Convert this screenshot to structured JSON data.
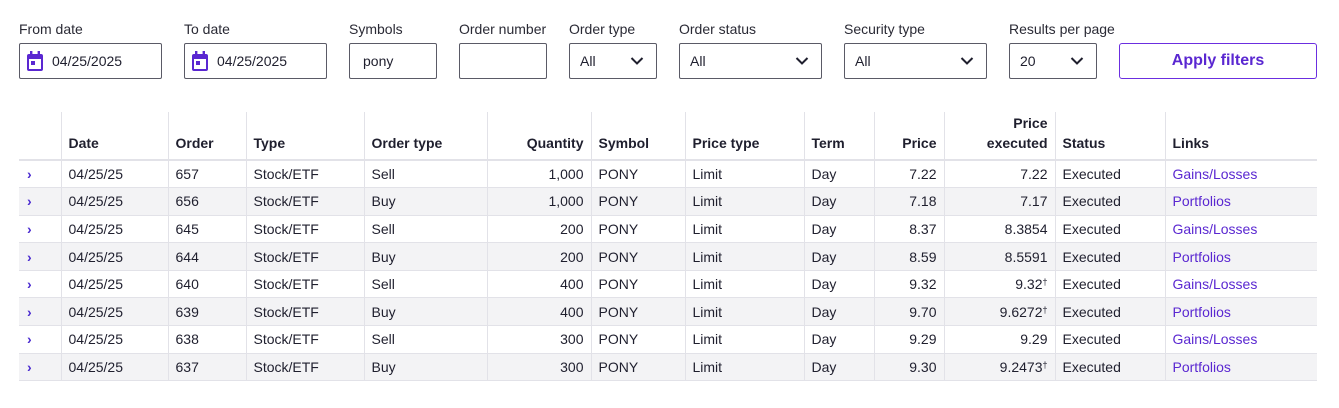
{
  "filters": {
    "from_date": {
      "label": "From date",
      "value": "04/25/2025"
    },
    "to_date": {
      "label": "To date",
      "value": "04/25/2025"
    },
    "symbols": {
      "label": "Symbols",
      "value": "pony"
    },
    "order_number": {
      "label": "Order number",
      "value": ""
    },
    "order_type": {
      "label": "Order type",
      "value": "All"
    },
    "order_status": {
      "label": "Order status",
      "value": "All"
    },
    "security_type": {
      "label": "Security type",
      "value": "All"
    },
    "results_per_page": {
      "label": "Results per page",
      "value": "20"
    },
    "apply_label": "Apply filters"
  },
  "table": {
    "headers": {
      "date": "Date",
      "order": "Order",
      "type": "Type",
      "order_type": "Order type",
      "quantity": "Quantity",
      "symbol": "Symbol",
      "price_type": "Price type",
      "term": "Term",
      "price": "Price",
      "price_executed_1": "Price",
      "price_executed_2": "executed",
      "status": "Status",
      "links": "Links"
    },
    "rows": [
      {
        "date": "04/25/25",
        "order": "657",
        "type": "Stock/ETF",
        "order_type": "Sell",
        "quantity": "1,000",
        "symbol": "PONY",
        "price_type": "Limit",
        "term": "Day",
        "price": "7.22",
        "price_executed": "7.22",
        "dagger": "",
        "status": "Executed",
        "link": "Gains/Losses"
      },
      {
        "date": "04/25/25",
        "order": "656",
        "type": "Stock/ETF",
        "order_type": "Buy",
        "quantity": "1,000",
        "symbol": "PONY",
        "price_type": "Limit",
        "term": "Day",
        "price": "7.18",
        "price_executed": "7.17",
        "dagger": "",
        "status": "Executed",
        "link": "Portfolios"
      },
      {
        "date": "04/25/25",
        "order": "645",
        "type": "Stock/ETF",
        "order_type": "Sell",
        "quantity": "200",
        "symbol": "PONY",
        "price_type": "Limit",
        "term": "Day",
        "price": "8.37",
        "price_executed": "8.3854",
        "dagger": "",
        "status": "Executed",
        "link": "Gains/Losses"
      },
      {
        "date": "04/25/25",
        "order": "644",
        "type": "Stock/ETF",
        "order_type": "Buy",
        "quantity": "200",
        "symbol": "PONY",
        "price_type": "Limit",
        "term": "Day",
        "price": "8.59",
        "price_executed": "8.5591",
        "dagger": "",
        "status": "Executed",
        "link": "Portfolios"
      },
      {
        "date": "04/25/25",
        "order": "640",
        "type": "Stock/ETF",
        "order_type": "Sell",
        "quantity": "400",
        "symbol": "PONY",
        "price_type": "Limit",
        "term": "Day",
        "price": "9.32",
        "price_executed": "9.32",
        "dagger": "†",
        "status": "Executed",
        "link": "Gains/Losses"
      },
      {
        "date": "04/25/25",
        "order": "639",
        "type": "Stock/ETF",
        "order_type": "Buy",
        "quantity": "400",
        "symbol": "PONY",
        "price_type": "Limit",
        "term": "Day",
        "price": "9.70",
        "price_executed": "9.6272",
        "dagger": "†",
        "status": "Executed",
        "link": "Portfolios"
      },
      {
        "date": "04/25/25",
        "order": "638",
        "type": "Stock/ETF",
        "order_type": "Sell",
        "quantity": "300",
        "symbol": "PONY",
        "price_type": "Limit",
        "term": "Day",
        "price": "9.29",
        "price_executed": "9.29",
        "dagger": "",
        "status": "Executed",
        "link": "Gains/Losses"
      },
      {
        "date": "04/25/25",
        "order": "637",
        "type": "Stock/ETF",
        "order_type": "Buy",
        "quantity": "300",
        "symbol": "PONY",
        "price_type": "Limit",
        "term": "Day",
        "price": "9.30",
        "price_executed": "9.2473",
        "dagger": "†",
        "status": "Executed",
        "link": "Portfolios"
      }
    ]
  },
  "icons": {
    "expand": "›",
    "calendar": "calendar-icon",
    "chevron": "chevron-down-icon"
  },
  "colors": {
    "accent": "#5a27d1",
    "text": "#1f1f2e",
    "row_alt": "#f3f3f5"
  }
}
